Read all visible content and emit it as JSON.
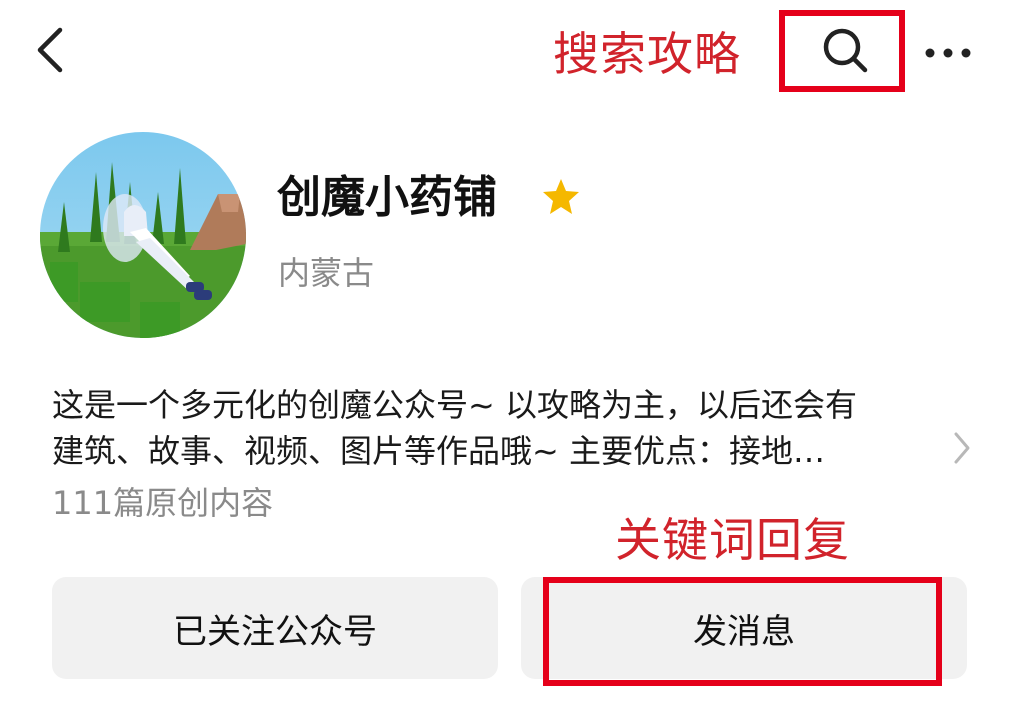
{
  "header": {
    "back_icon": "chevron-left-icon",
    "search_annotation": "搜索攻略",
    "search_icon": "search-icon",
    "more_icon": "more-dots-icon",
    "highlight_color": "#e5001a",
    "annotation_color": "#d1232b"
  },
  "profile": {
    "name": "创魔小药铺",
    "badge_icon": "star-icon",
    "badge_color": "#f5b800",
    "region": "内蒙古",
    "description_lines": [
      "这是一个多元化的创魔公众号~ 以攻略为主，以后还会有",
      "建筑、故事、视频、图片等作品哦~ 主要优点：接地…"
    ],
    "post_count": "111篇原创内容"
  },
  "annotations": {
    "keyword_reply": "关键词回复"
  },
  "actions": {
    "follow_label": "已关注公众号",
    "message_label": "发消息"
  }
}
